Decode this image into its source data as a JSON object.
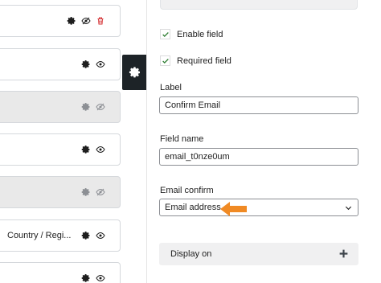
{
  "fields_list": {
    "rows": [
      {
        "label": "",
        "state": "active",
        "icons": [
          "gear-icon",
          "eye-slash-icon",
          "trash-icon"
        ]
      },
      {
        "label": "",
        "state": "active",
        "icons": [
          "gear-icon",
          "eye-icon"
        ]
      },
      {
        "label": "",
        "state": "disabled",
        "icons": [
          "gear-icon",
          "eye-slash-icon"
        ]
      },
      {
        "label": "",
        "state": "active",
        "icons": [
          "gear-icon",
          "eye-icon"
        ]
      },
      {
        "label": "",
        "state": "disabled",
        "icons": [
          "gear-icon",
          "eye-slash-icon"
        ]
      },
      {
        "label": "Country / Regi...",
        "state": "active",
        "icons": [
          "gear-icon",
          "eye-icon"
        ]
      },
      {
        "label": "",
        "state": "active",
        "icons": [
          "gear-icon",
          "eye-icon"
        ]
      }
    ]
  },
  "settings_tab": {
    "icon": "gear-icon"
  },
  "field_settings": {
    "enable_field_label": "Enable field",
    "enable_field_checked": true,
    "required_field_label": "Required field",
    "required_field_checked": true,
    "label_title": "Label",
    "label_value": "Confirm Email",
    "field_name_title": "Field name",
    "field_name_value": "email_t0nze0um",
    "email_confirm_title": "Email confirm",
    "email_confirm_value": "Email address",
    "display_on_label": "Display on"
  },
  "colors": {
    "check": "#2e7d32",
    "arrow": "#f08a24",
    "trash": "#d63638",
    "tab_bg": "#1d2327"
  }
}
